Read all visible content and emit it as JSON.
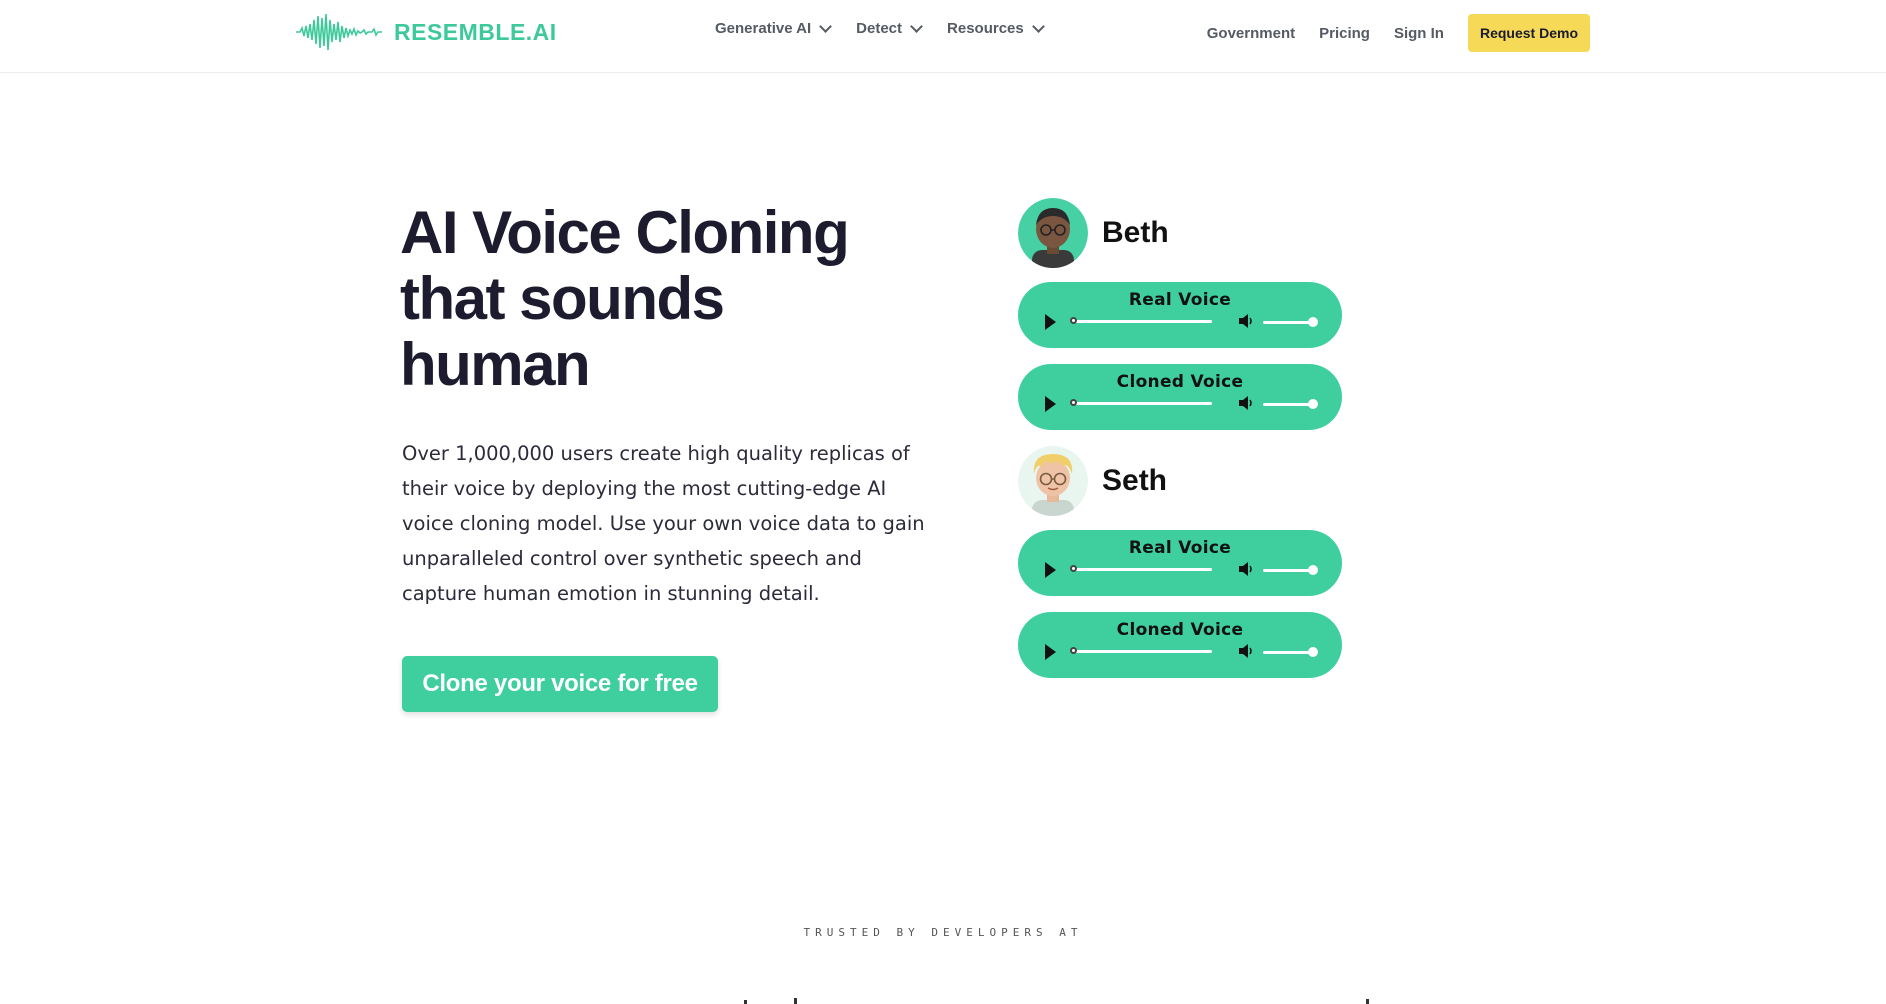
{
  "header": {
    "logo_text": "RESEMBLE.AI",
    "nav": [
      {
        "label": "Generative AI"
      },
      {
        "label": "Detect"
      },
      {
        "label": "Resources"
      }
    ],
    "links": {
      "government": "Government",
      "pricing": "Pricing",
      "sign_in": "Sign In"
    },
    "request_demo": "Request Demo"
  },
  "hero": {
    "title_line1": "AI Voice Cloning",
    "title_line2": "that sounds",
    "title_line3": "human",
    "description": "Over 1,000,000 users create high quality replicas of their voice by deploying the most cutting-edge AI voice cloning model. Use your own voice data to gain unparalleled control over synthetic speech  and capture human emotion in stunning detail.",
    "cta": "Clone your voice for free"
  },
  "voices": [
    {
      "name": "Beth",
      "players": [
        {
          "label": "Real Voice",
          "progress": 0,
          "volume": 1
        },
        {
          "label": "Cloned Voice",
          "progress": 0,
          "volume": 1
        }
      ]
    },
    {
      "name": "Seth",
      "players": [
        {
          "label": "Real Voice",
          "progress": 0,
          "volume": 1
        },
        {
          "label": "Cloned Voice",
          "progress": 0,
          "volume": 1
        }
      ]
    }
  ],
  "trusted_label": "TRUSTED BY DEVELOPERS AT",
  "colors": {
    "brand_green": "#3fcf9f",
    "demo_yellow": "#f5d957",
    "heading": "#1d1b2e"
  },
  "icons": [
    "logo-waveform-icon",
    "chevron-down-icon",
    "play-icon",
    "speaker-icon"
  ]
}
